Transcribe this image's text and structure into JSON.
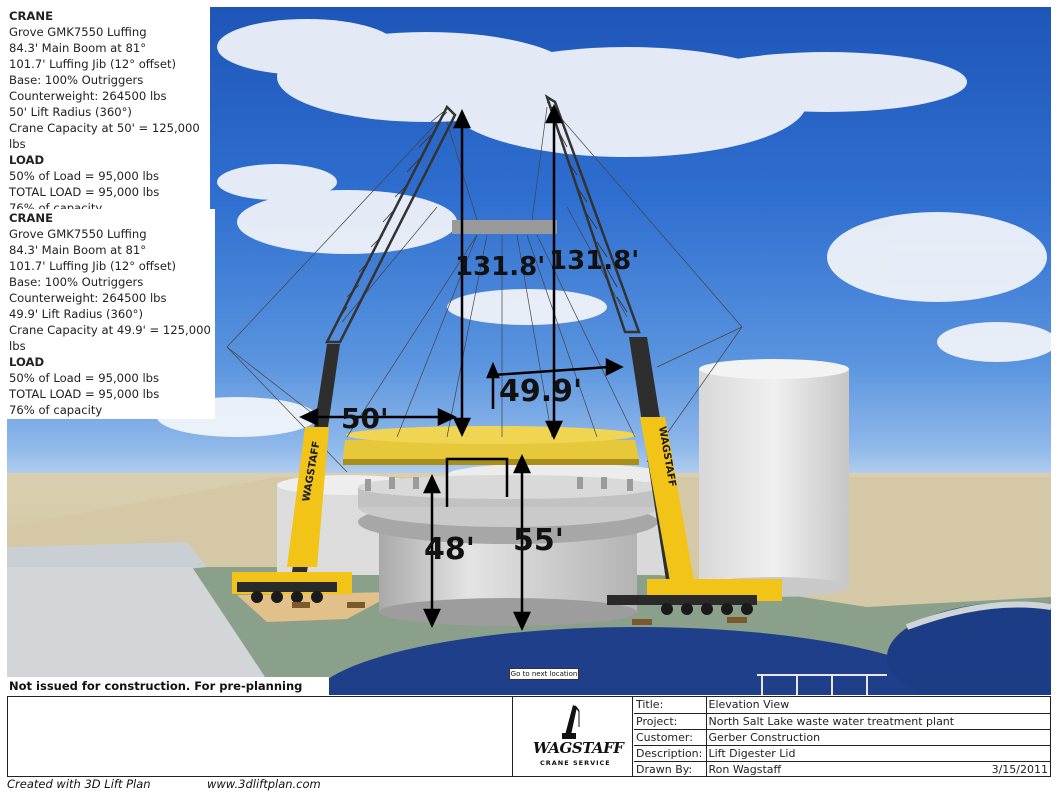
{
  "crane_a": {
    "title": "CRANE",
    "lines": [
      "Grove GMK7550 Luffing",
      "84.3' Main Boom at 81°",
      "101.7' Luffing Jib (12° offset)",
      "Base: 100% Outriggers",
      "Counterweight: 264500 lbs",
      "50' Lift Radius (360°)",
      "Crane Capacity at 50' = 125,000 lbs"
    ]
  },
  "load_a": {
    "title": "LOAD",
    "lines": [
      "50% of Load  =  95,000 lbs",
      "TOTAL LOAD  =  95,000 lbs",
      "76% of capacity"
    ]
  },
  "crane_b": {
    "title": "CRANE",
    "lines": [
      "Grove GMK7550 Luffing",
      "84.3' Main Boom at 81°",
      "101.7' Luffing Jib (12° offset)",
      "Base: 100% Outriggers",
      "Counterweight: 264500 lbs",
      "49.9' Lift Radius (360°)",
      "Crane Capacity at 49.9' = 125,000 lbs"
    ]
  },
  "load_b": {
    "title": "LOAD",
    "lines": [
      "50% of Load  =  95,000 lbs",
      "TOTAL LOAD  =  95,000 lbs",
      "76% of capacity"
    ]
  },
  "dimensions": {
    "left_height": "131.8'",
    "right_height": "131.8'",
    "left_radius": "50'",
    "right_radius": "49.9'",
    "tank_height_a": "48'",
    "tank_height_b": "55'"
  },
  "crane_brand": "WAGSTAFF",
  "notice": "Not issued for construction. For pre-planning only.",
  "next_location_button": "Go to next location",
  "title_block": {
    "logo_text": "WAGSTAFF",
    "logo_subtext": "CRANE SERVICE",
    "rows": [
      {
        "label": "Title:",
        "value": "Elevation View"
      },
      {
        "label": "Project:",
        "value": "North Salt Lake waste water treatment plant"
      },
      {
        "label": "Customer:",
        "value": "Gerber Construction"
      },
      {
        "label": "Description:",
        "value": "Lift Digester Lid"
      },
      {
        "label": "Drawn By:",
        "value": "Ron Wagstaff",
        "date": "3/15/2011"
      }
    ]
  },
  "footer": {
    "created": "Created with 3D Lift Plan",
    "url": "www.3dliftplan.com"
  },
  "colors": {
    "crane_yellow": "#f2c418",
    "boom_dark": "#2e2e2e",
    "lid_yellow": "#e9c93a",
    "tank_gray": "#d6d6d6",
    "sky_blue": "#2f6fd0"
  }
}
